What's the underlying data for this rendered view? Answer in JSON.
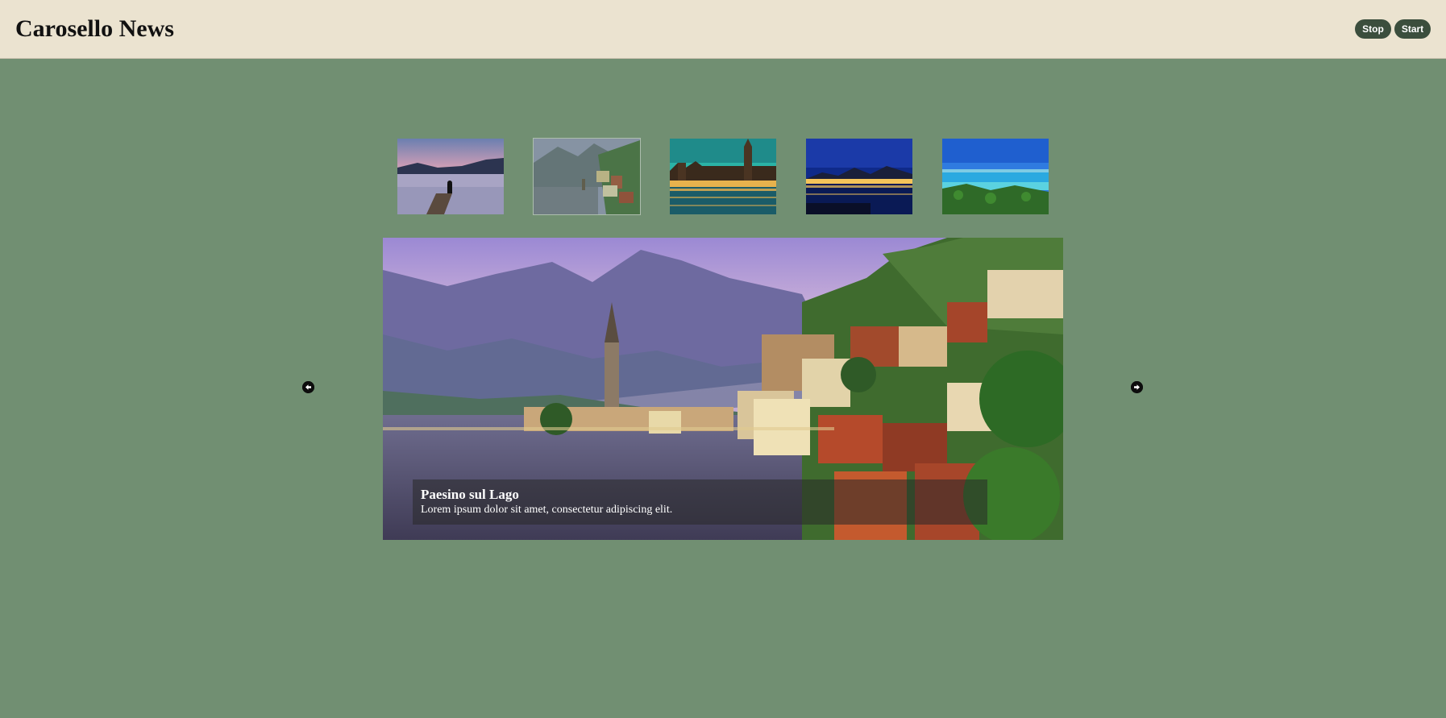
{
  "header": {
    "title": "Carosello News",
    "stop_label": "Stop",
    "start_label": "Start",
    "background": "#ebe3d0",
    "button_color": "#3b4e3d"
  },
  "page": {
    "background": "#718f72"
  },
  "thumbnails": [
    {
      "name": "lake-dock-sunset",
      "active": false
    },
    {
      "name": "lakeside-village",
      "active": true
    },
    {
      "name": "london-parliament-night",
      "active": false
    },
    {
      "name": "city-night-river",
      "active": false
    },
    {
      "name": "sea-coast",
      "active": false
    }
  ],
  "slide": {
    "caption_title": "Paesino sul Lago",
    "caption_text": "Lorem ipsum dolor sit amet, consectetur adipiscing elit."
  },
  "nav": {
    "prev_icon": "arrow-left-circle-icon",
    "next_icon": "arrow-right-circle-icon"
  }
}
